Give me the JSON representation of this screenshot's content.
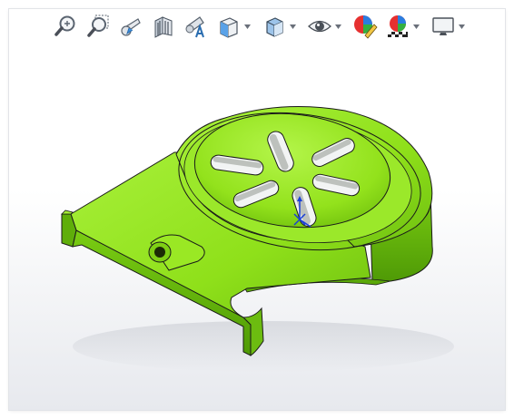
{
  "heads_up_toolbar": {
    "tools": [
      {
        "name": "zoom-to-fit",
        "icon": "zoom-to-fit-icon",
        "has_dropdown": false
      },
      {
        "name": "zoom-to-area",
        "icon": "zoom-to-area-icon",
        "has_dropdown": false
      },
      {
        "name": "previous-view",
        "icon": "previous-view-icon",
        "has_dropdown": false
      },
      {
        "name": "section-view",
        "icon": "section-view-icon",
        "has_dropdown": false
      },
      {
        "name": "dynamic-annotation-views",
        "icon": "dynamic-annotation-icon",
        "has_dropdown": false
      },
      {
        "name": "view-orientation",
        "icon": "view-orientation-icon",
        "has_dropdown": true
      },
      {
        "name": "display-style",
        "icon": "display-style-icon",
        "has_dropdown": true
      },
      {
        "name": "hide-show-items",
        "icon": "hide-show-eye-icon",
        "has_dropdown": true
      },
      {
        "name": "edit-appearance",
        "icon": "edit-appearance-icon",
        "has_dropdown": false
      },
      {
        "name": "apply-scene",
        "icon": "apply-scene-icon",
        "has_dropdown": true
      },
      {
        "name": "view-settings",
        "icon": "monitor-icon",
        "has_dropdown": true
      }
    ]
  },
  "model": {
    "part_color": "#8fe01a",
    "edge_color": "#1a1a1a",
    "triad_color": "#1a3fd8",
    "slot_count": 6
  }
}
